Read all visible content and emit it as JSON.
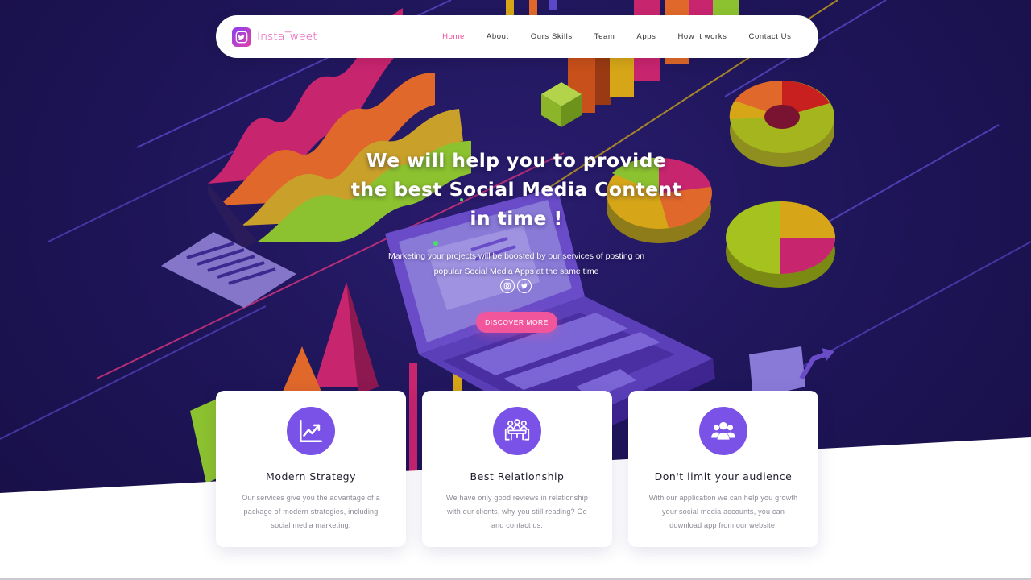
{
  "navbar": {
    "brand": "InstaTweet",
    "links": [
      {
        "label": "Home",
        "active": true
      },
      {
        "label": "About"
      },
      {
        "label": "Ours Skills"
      },
      {
        "label": "Team"
      },
      {
        "label": "Apps"
      },
      {
        "label": "How it works"
      },
      {
        "label": "Contact Us"
      }
    ]
  },
  "hero": {
    "title_line1": "We will help you to provide",
    "title_line2_pre": "the best",
    "title_line2_strong": "Social Media",
    "title_line2_post": "Content",
    "title_line3": "in time !",
    "subtitle_line1": "Marketing your projects will be boosted by our services of posting on",
    "subtitle_line2": "popular Social Media Apps at the same time",
    "social_icons": [
      "instagram-icon",
      "twitter-icon"
    ],
    "cta_label": "DISCOVER MORE"
  },
  "cards": [
    {
      "icon": "trending-up-icon",
      "title": "Modern Strategy",
      "text": "Our services give you the advantage of a package of modern strategies, including social media marketing."
    },
    {
      "icon": "meeting-table-icon",
      "title": "Best Relationship",
      "text": "We have only good reviews in relationship with our clients, why you still reading? Go and contact us."
    },
    {
      "icon": "users-group-icon",
      "title": "Don't limit your audience",
      "text": "With our application we can help you growth your social media accounts, you can download app from our website."
    }
  ],
  "colors": {
    "accent": "#f1569c",
    "brand_purple": "#7b52e8",
    "hero_bg": "#1d1456"
  }
}
